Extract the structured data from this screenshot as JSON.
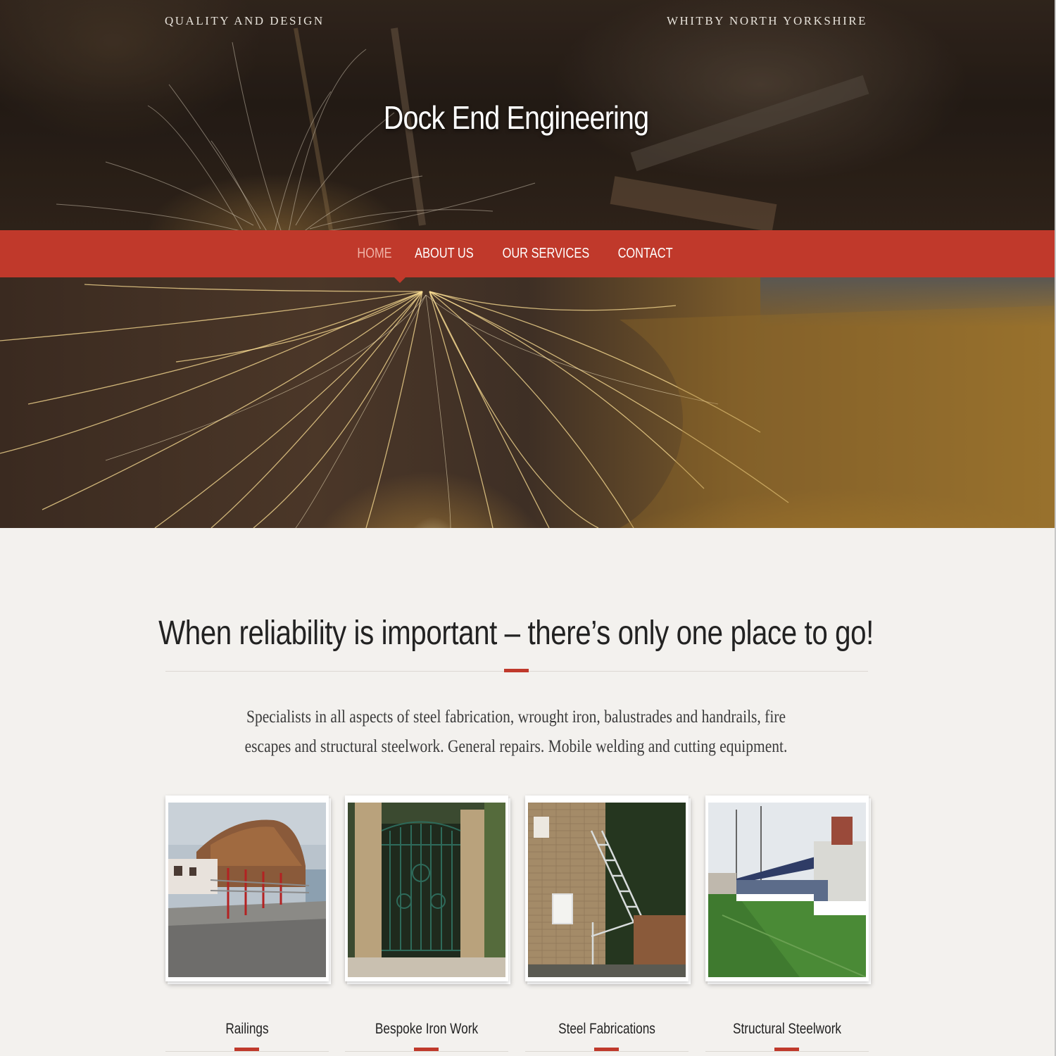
{
  "header": {
    "tagline_left": "QUALITY AND DESIGN",
    "tagline_right": "WHITBY NORTH YORKSHIRE",
    "site_title": "Dock End Engineering"
  },
  "nav": {
    "items": [
      {
        "label": "HOME",
        "active": true
      },
      {
        "label": "ABOUT US"
      },
      {
        "label": "OUR SERVICES"
      },
      {
        "label": "CONTACT"
      }
    ]
  },
  "main": {
    "headline": "When reliability is important – there’s only one place to go!",
    "intro": "Specialists in all aspects of steel fabrication, wrought iron, balustrades and handrails, fire escapes and structural steelwork. General repairs. Mobile welding and cutting equipment.",
    "services": [
      {
        "title": "Railings"
      },
      {
        "title": "Bespoke Iron Work"
      },
      {
        "title": "Steel Fabrications"
      },
      {
        "title": "Structural Steelwork"
      }
    ]
  },
  "colors": {
    "accent": "#c0392b",
    "background": "#f3f1ee",
    "text": "#222222"
  }
}
